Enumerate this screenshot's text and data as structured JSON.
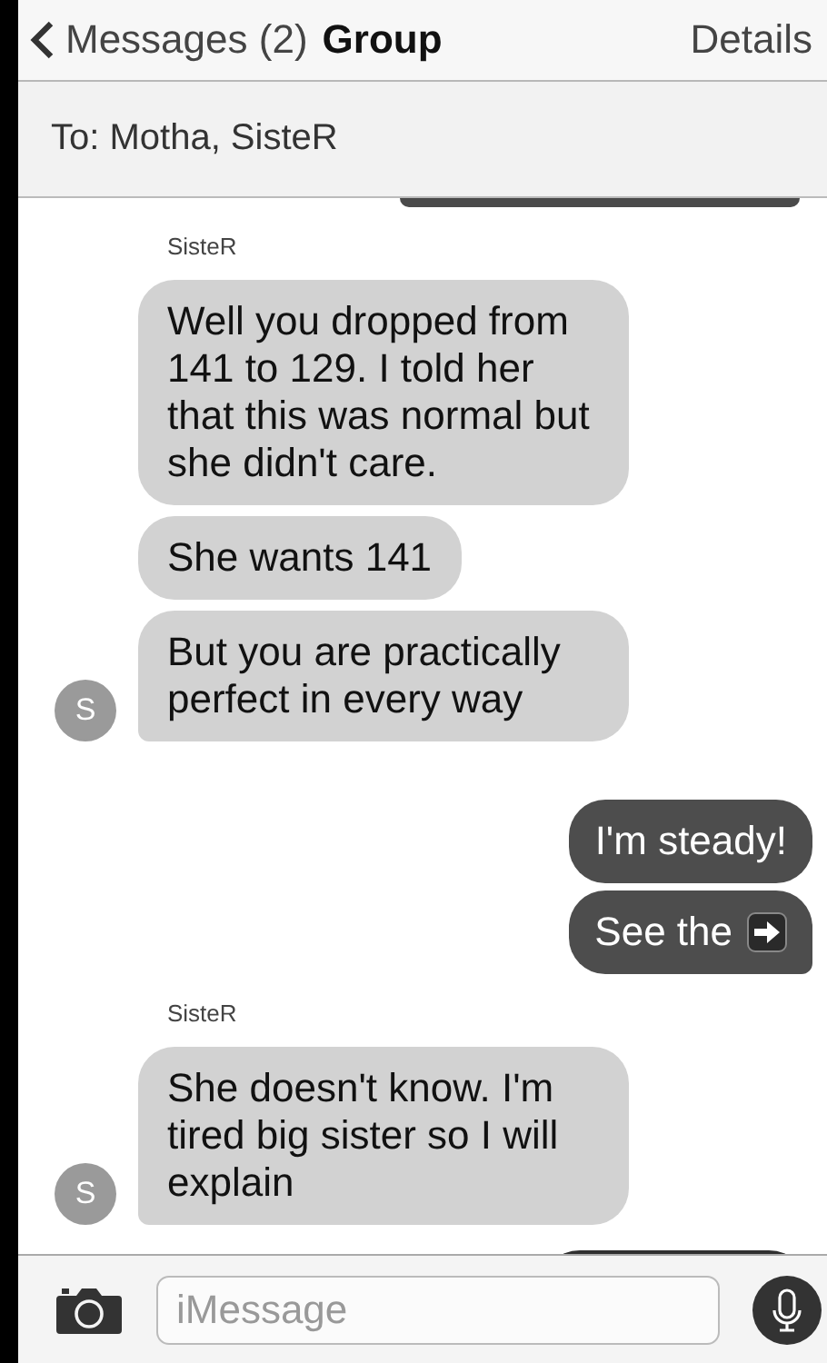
{
  "nav": {
    "back": "Messages (2)",
    "title": "Group",
    "action": "Details"
  },
  "recipients": "To: Motha, SisteR",
  "thread": [
    {
      "kind": "incoming",
      "sender": "SisteR",
      "avatar": "S",
      "bubbles": [
        {
          "kind": "text",
          "text": "Well you dropped from 141 to 129. I told her that this was normal but she didn't care."
        },
        {
          "kind": "text",
          "text": "She wants 141"
        },
        {
          "kind": "text",
          "text": "But you are practically perfect in every way"
        }
      ]
    },
    {
      "kind": "outgoing",
      "bubbles": [
        {
          "kind": "text",
          "text": "I'm steady!"
        },
        {
          "kind": "arrow",
          "text": "See the"
        }
      ]
    },
    {
      "kind": "incoming",
      "sender": "SisteR",
      "avatar": "S",
      "bubbles": [
        {
          "kind": "text",
          "text": "She doesn't know. I'm tired big sister so I will explain"
        }
      ]
    }
  ],
  "composer": {
    "placeholder": "iMessage"
  }
}
